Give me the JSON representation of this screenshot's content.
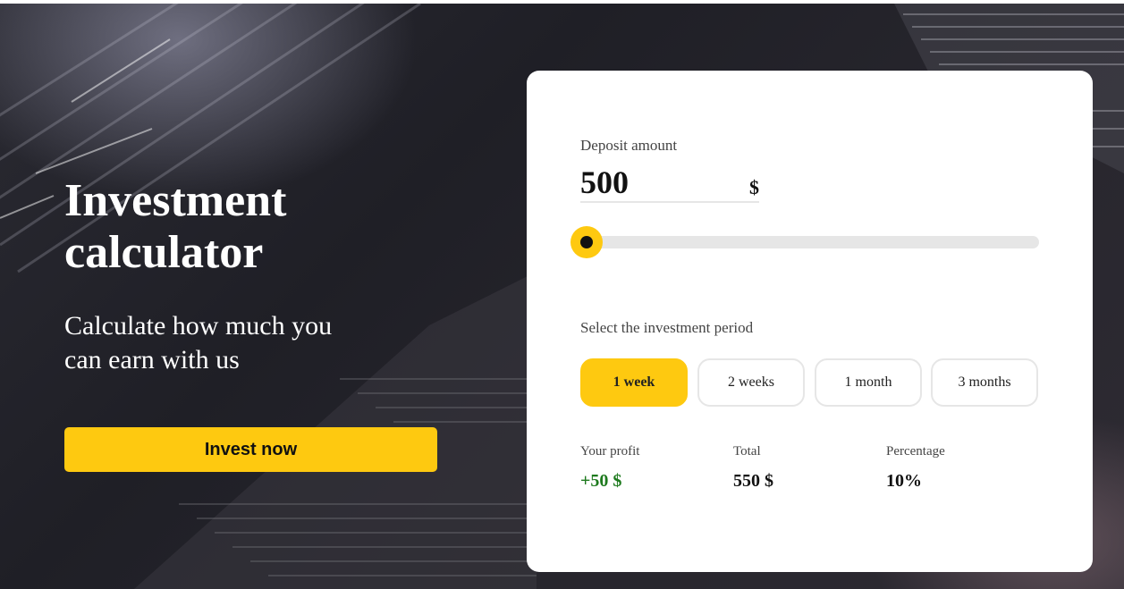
{
  "hero": {
    "title": "Investment calculator",
    "subtitle": "Calculate how much you can earn with us",
    "cta_label": "Invest now"
  },
  "calculator": {
    "deposit_label": "Deposit amount",
    "deposit_value": "500",
    "currency_symbol": "$",
    "slider_fraction": 0.0,
    "period_label": "Select the investment period",
    "periods": [
      {
        "label": "1 week",
        "selected": true
      },
      {
        "label": "2 weeks",
        "selected": false
      },
      {
        "label": "1 month",
        "selected": false
      },
      {
        "label": "3 months",
        "selected": false
      }
    ],
    "results": {
      "profit_label": "Your profit",
      "profit_value": "+50 $",
      "total_label": "Total",
      "total_value": "550 $",
      "percentage_label": "Percentage",
      "percentage_value": "10%"
    }
  },
  "colors": {
    "accent": "#fec910",
    "profit": "#1e7a1e",
    "background": "#24232a"
  }
}
